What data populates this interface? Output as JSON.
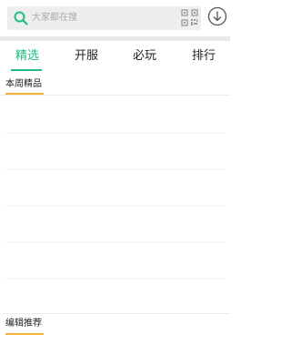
{
  "search": {
    "placeholder": "大家都在搜"
  },
  "tabs": [
    {
      "label": "精选",
      "active": true
    },
    {
      "label": "开服",
      "active": false
    },
    {
      "label": "必玩",
      "active": false
    },
    {
      "label": "排行",
      "active": false
    }
  ],
  "sections": {
    "weekly": {
      "title": "本周精品"
    },
    "editor": {
      "title": "编辑推荐"
    }
  },
  "colors": {
    "accent": "#1fbd80",
    "section_underline": "#f3b23a",
    "search_bg": "#eeeeee"
  },
  "icons": {
    "search": "search-icon",
    "qr": "qr-code-icon",
    "download": "download-icon"
  }
}
